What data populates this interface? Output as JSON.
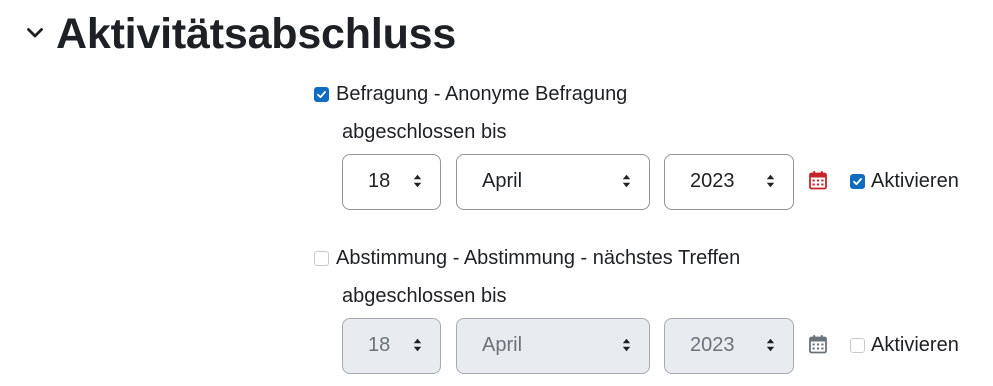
{
  "section": {
    "title": "Aktivitätsabschluss",
    "toggle_icon": "chevron-down-icon"
  },
  "colors": {
    "checkbox_checked": "#0f6cbf",
    "calendar_active": "#c4252a",
    "calendar_disabled": "#6a737b",
    "disabled_field": "#e9ecef",
    "text": "#1d2125"
  },
  "items": [
    {
      "checked": true,
      "label": "Befragung - Anonyme Befragung",
      "sub_label": "abgeschlossen bis",
      "day": "18",
      "month": "April",
      "year": "2023",
      "enabled": true,
      "enable_label": "Aktivieren",
      "calendar_icon": "calendar-icon"
    },
    {
      "checked": false,
      "label": "Abstimmung - Abstimmung - nächstes Treffen",
      "sub_label": "abgeschlossen bis",
      "day": "18",
      "month": "April",
      "year": "2023",
      "enabled": false,
      "enable_label": "Aktivieren",
      "calendar_icon": "calendar-icon"
    }
  ]
}
